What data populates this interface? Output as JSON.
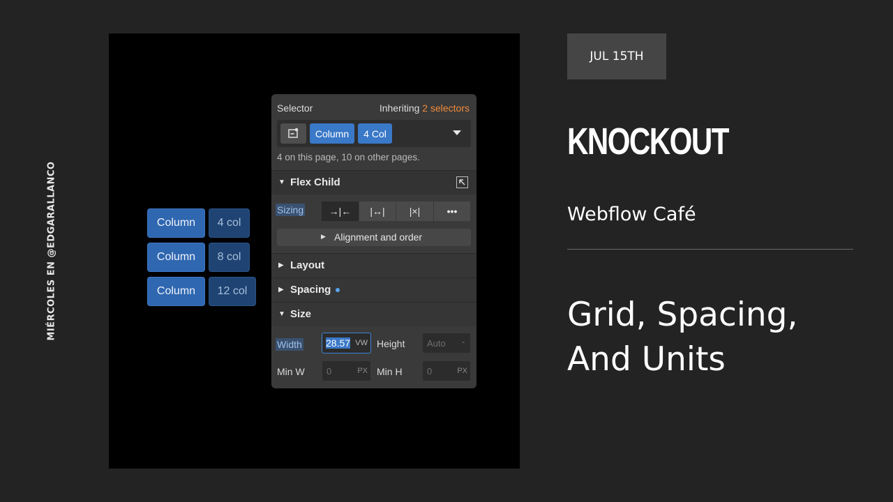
{
  "side_caption": "MIÉRCOLES EN @EDGARALLANCO",
  "chips": [
    {
      "col_label": "Column",
      "span_label": "4 col"
    },
    {
      "col_label": "Column",
      "span_label": "8 col"
    },
    {
      "col_label": "Column",
      "span_label": "12 col"
    }
  ],
  "panel": {
    "selector_label": "Selector",
    "inheriting_prefix": "Inheriting",
    "inheriting_count": "2 selectors",
    "selector_pills": [
      "Column",
      "4 Col"
    ],
    "usage_text": "4 on this page, 10 on other pages.",
    "flex_child_title": "Flex Child",
    "sizing_label": "Sizing",
    "sizing_options": [
      "→|←",
      "|↔|",
      "|×|",
      "•••"
    ],
    "alignment_label": "Alignment and order",
    "sections": [
      "Layout",
      "Spacing",
      "Size"
    ],
    "width_label": "Width",
    "width_value": "28.57",
    "width_unit": "VW",
    "height_label": "Height",
    "height_value": "Auto",
    "height_unit": "-",
    "min_w_label": "Min W",
    "min_w_value": "0",
    "min_w_unit": "PX",
    "min_h_label": "Min H",
    "min_h_value": "0",
    "min_h_unit": "PX"
  },
  "date": "JUL 15TH",
  "brand": "KNOCKOUT",
  "subtitle": "Webflow Café",
  "headline_line1": "Grid, Spacing,",
  "headline_line2": "And Units",
  "colors": {
    "accent_orange": "#f08a3c",
    "accent_blue": "#3a78c8",
    "background": "#232323"
  }
}
